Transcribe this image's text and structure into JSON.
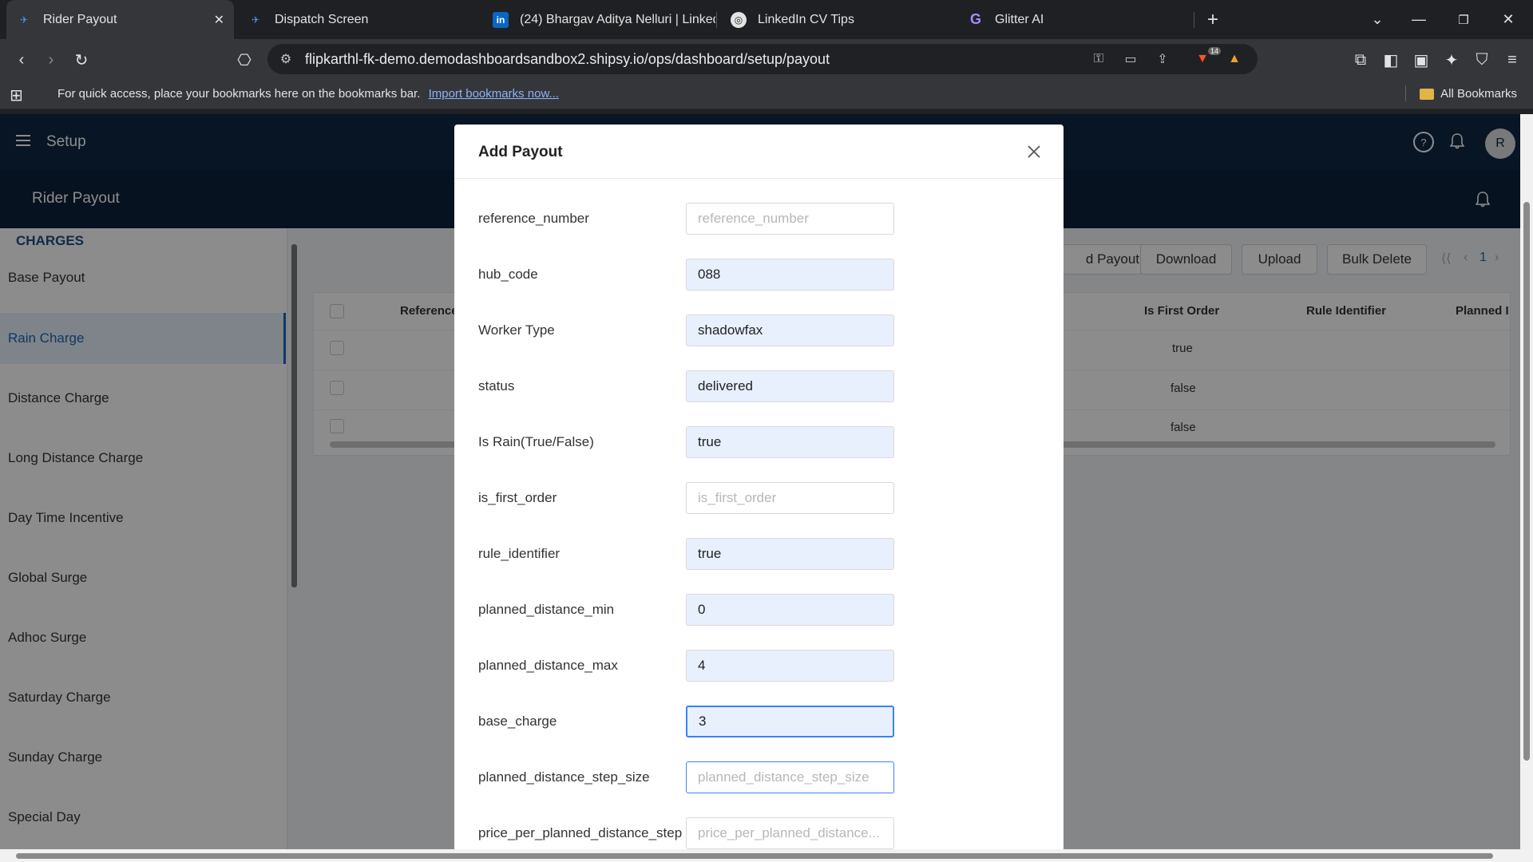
{
  "browser": {
    "tabs": [
      {
        "label": "Rider Payout",
        "active": true
      },
      {
        "label": "Dispatch Screen",
        "active": false
      },
      {
        "label": "(24) Bhargav Aditya Nelluri | LinkedI",
        "active": false
      },
      {
        "label": "LinkedIn CV Tips",
        "active": false
      },
      {
        "label": "Glitter AI",
        "active": false
      }
    ],
    "url": "flipkarthl-fk-demo.demodashboardsandbox2.shipsy.io/ops/dashboard/setup/payout",
    "extension_badge": "14",
    "bookmarks_message": "For quick access, place your bookmarks here on the bookmarks bar.",
    "bookmarks_link": "Import bookmarks now...",
    "all_bookmarks": "All Bookmarks"
  },
  "app": {
    "header_title": "Setup",
    "avatar_initial": "R",
    "help_glyph": "?",
    "sub_title": "Rider Payout",
    "sidebar": {
      "section": "CHARGES",
      "items": [
        {
          "label": "Base Payout"
        },
        {
          "label": "Rain Charge",
          "active": true
        },
        {
          "label": "Distance Charge"
        },
        {
          "label": "Long Distance Charge"
        },
        {
          "label": "Day Time Incentive"
        },
        {
          "label": "Global Surge"
        },
        {
          "label": "Adhoc Surge"
        },
        {
          "label": "Saturday Charge"
        },
        {
          "label": "Sunday Charge"
        },
        {
          "label": "Special Day"
        }
      ]
    },
    "toolbar": {
      "add_payout": "d Payout",
      "download": "Download",
      "upload": "Upload",
      "bulk_delete": "Bulk Delete",
      "page": "1"
    },
    "table": {
      "columns": [
        "Reference",
        "Is First Order",
        "Rule Identifier",
        "Planned I"
      ],
      "rows": [
        {
          "is_first_order": "true"
        },
        {
          "is_first_order": "false"
        },
        {
          "is_first_order": "false"
        }
      ]
    }
  },
  "modal": {
    "title": "Add Payout",
    "fields": [
      {
        "label": "reference_number",
        "value": "",
        "placeholder": "reference_number"
      },
      {
        "label": "hub_code",
        "value": "088",
        "placeholder": "hub_code"
      },
      {
        "label": "Worker Type",
        "value": "shadowfax",
        "placeholder": "Worker Type"
      },
      {
        "label": "status",
        "value": "delivered",
        "placeholder": "status"
      },
      {
        "label": "Is Rain(True/False)",
        "value": "true",
        "placeholder": "Is Rain(True/False)"
      },
      {
        "label": "is_first_order",
        "value": "",
        "placeholder": "is_first_order"
      },
      {
        "label": "rule_identifier",
        "value": "true",
        "placeholder": "rule_identifier"
      },
      {
        "label": "planned_distance_min",
        "value": "0",
        "placeholder": "planned_distance_min"
      },
      {
        "label": "planned_distance_max",
        "value": "4",
        "placeholder": "planned_distance_max"
      },
      {
        "label": "base_charge",
        "value": "3",
        "placeholder": "base_charge"
      },
      {
        "label": "planned_distance_step_size",
        "value": "",
        "placeholder": "planned_distance_step_size"
      },
      {
        "label": "price_per_planned_distance_step",
        "value": "",
        "placeholder": "price_per_planned_distance..."
      }
    ]
  },
  "colors": {
    "header": "#0f2744",
    "accent": "#1c64b4",
    "filled_input": "#e8f0fe"
  }
}
